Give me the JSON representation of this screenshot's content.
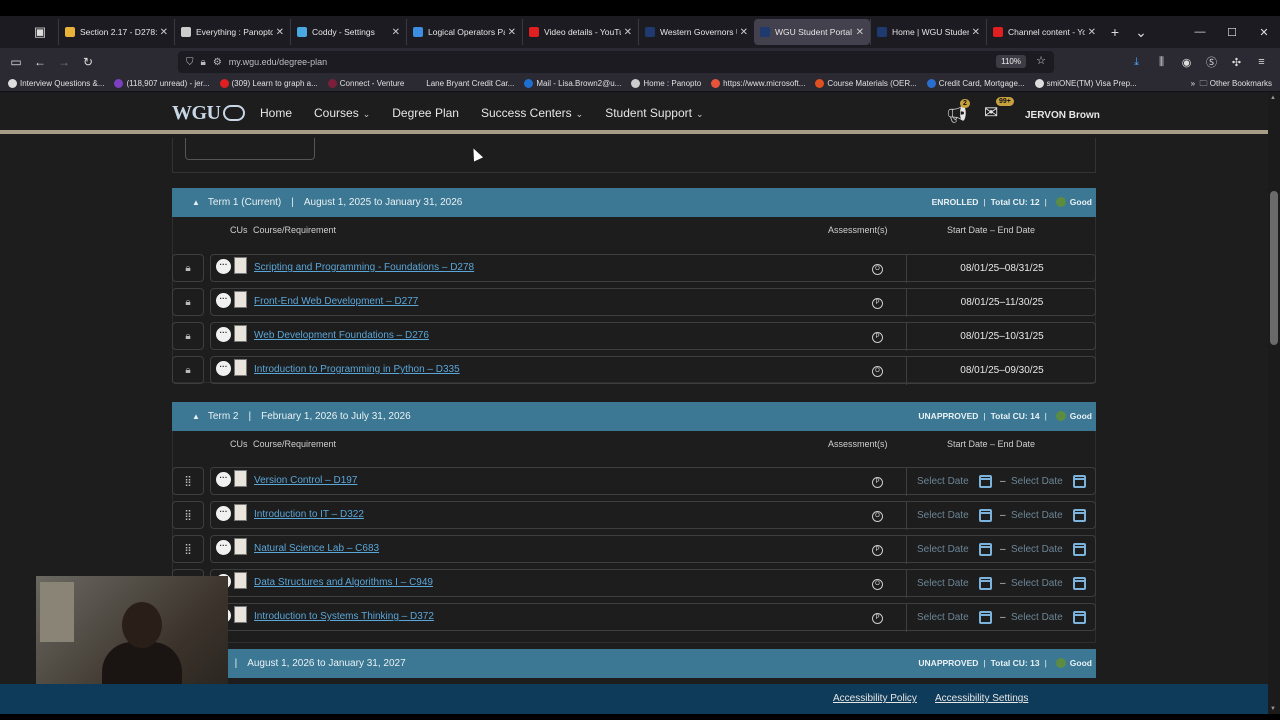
{
  "browser": {
    "tabs": [
      {
        "label": "Section 2.17 - D278: ",
        "color": "#e8b338",
        "active": false
      },
      {
        "label": "Everything : Panopto",
        "color": "#cccccc",
        "active": false
      },
      {
        "label": "Coddy - Settings",
        "color": "#49a8e0",
        "active": false
      },
      {
        "label": "Logical Operators Pa",
        "color": "#3d8de0",
        "active": false
      },
      {
        "label": "Video details - YouTu",
        "color": "#e02020",
        "active": false
      },
      {
        "label": "Western Governors U",
        "color": "#1f3a6e",
        "active": false
      },
      {
        "label": "WGU Student Portal",
        "color": "#1f3a6e",
        "active": true
      },
      {
        "label": "Home | WGU Student",
        "color": "#1f3a6e",
        "active": false
      },
      {
        "label": "Channel content - Yo",
        "color": "#e02020",
        "active": false
      }
    ],
    "url": "my.wgu.edu/degree-plan",
    "zoom": "110%",
    "bookmarks": [
      {
        "label": "Interview Questions &...",
        "color": "#dddddd"
      },
      {
        "label": "(118,907 unread) - jer...",
        "color": "#7b3fbf"
      },
      {
        "label": "(309) Learn to graph a...",
        "color": "#e02020"
      },
      {
        "label": "Connect - Venture",
        "color": "#7a1f3a"
      },
      {
        "label": "Lane Bryant Credit Car...",
        "color": "#2b2a33"
      },
      {
        "label": "Mail - Lisa.Brown2@u...",
        "color": "#1e6fd0"
      },
      {
        "label": "Home : Panopto",
        "color": "#cccccc"
      },
      {
        "label": "https://www.microsoft...",
        "color": "#e8543a"
      },
      {
        "label": "Course Materials (OER...",
        "color": "#e05020"
      },
      {
        "label": "Credit Card, Mortgage...",
        "color": "#2a6fd0"
      },
      {
        "label": "smiONE(TM) Visa Prep...",
        "color": "#dddddd"
      }
    ],
    "other_bookmarks": "Other Bookmarks"
  },
  "header": {
    "logo": "WGU",
    "nav": [
      {
        "label": "Home",
        "dropdown": false
      },
      {
        "label": "Courses",
        "dropdown": true
      },
      {
        "label": "Degree Plan",
        "dropdown": false
      },
      {
        "label": "Success Centers",
        "dropdown": true
      },
      {
        "label": "Student Support",
        "dropdown": true
      }
    ],
    "notifications_count": "2",
    "messages_count": "99+",
    "user_name": "JERVON Brown"
  },
  "columns": {
    "cus": "CUs",
    "course": "Course/Requirement",
    "assessments": "Assessment(s)",
    "dates": "Start Date – End Date"
  },
  "terms": [
    {
      "name": "Term 1 (Current)",
      "range": "August 1, 2025 to January 31, 2026",
      "status": "ENROLLED",
      "total_cu": "Total CU: 12",
      "standing": "Good",
      "courses": [
        {
          "title": "Scripting and Programming - Foundations – D278",
          "assessment": "O",
          "dates": "08/01/25–08/31/25"
        },
        {
          "title": "Front-End Web Development – D277",
          "assessment": "P",
          "dates": "08/01/25–11/30/25"
        },
        {
          "title": "Web Development Foundations – D276",
          "assessment": "P",
          "dates": "08/01/25–10/31/25"
        },
        {
          "title": "Introduction to Programming in Python – D335",
          "assessment": "O",
          "dates": "08/01/25–09/30/25"
        }
      ]
    },
    {
      "name": "Term 2",
      "range": "February 1, 2026 to July 31, 2026",
      "status": "UNAPPROVED",
      "total_cu": "Total CU: 14",
      "standing": "Good",
      "courses": [
        {
          "title": "Version Control – D197",
          "assessment": "P"
        },
        {
          "title": "Introduction to IT – D322",
          "assessment": "O"
        },
        {
          "title": "Natural Science Lab – C683",
          "assessment": "P"
        },
        {
          "title": "Data Structures and Algorithms I – C949",
          "assessment": "O"
        },
        {
          "title": "Introduction to Systems Thinking – D372",
          "assessment": "P"
        }
      ]
    },
    {
      "name": "Term 3",
      "name_visible": "m 3",
      "range": "August 1, 2026 to January 31, 2027",
      "status": "UNAPPROVED",
      "total_cu": "Total CU: 13",
      "standing": "Good"
    }
  ],
  "select_date_placeholder": "Select Date",
  "footer": {
    "accessibility_policy": "Accessibility Policy",
    "accessibility_settings": "Accessibility Settings"
  },
  "icons": {
    "lock": "lock-icon",
    "drag": "drag-handle-icon",
    "calendar": "calendar-icon",
    "more": "more-icon",
    "bookmark": "bookmark-icon"
  }
}
